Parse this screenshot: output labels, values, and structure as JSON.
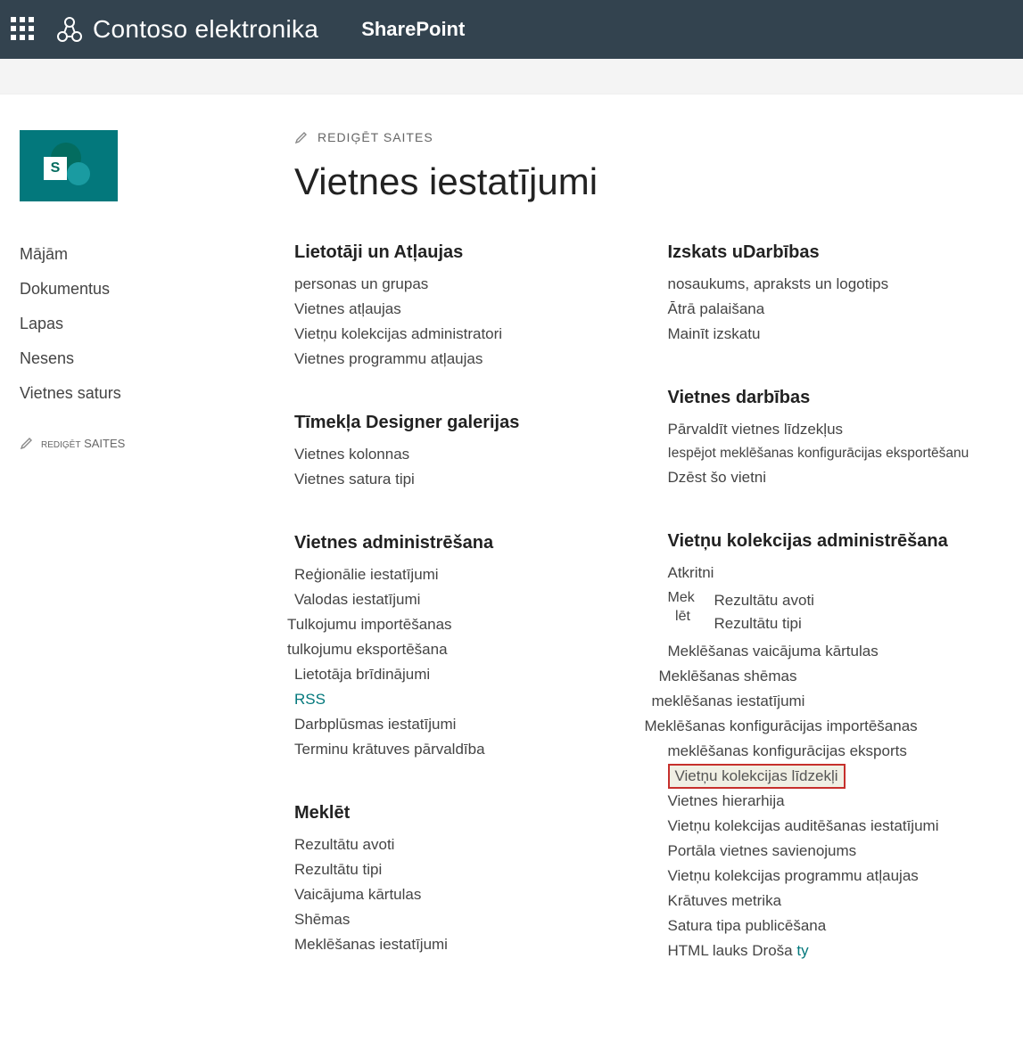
{
  "suite": {
    "brand": "Contoso elektronika",
    "product": "SharePoint"
  },
  "siteLogoLetter": "S",
  "nav": {
    "items": [
      "Mājām",
      "Dokumentus",
      "Lapas",
      "Nesens",
      "Vietnes saturs"
    ],
    "editLabel": "SAITES",
    "editPrefix": "REDIĢĒT"
  },
  "topEdit": "REDIĢĒT SAITES",
  "pageTitle": "Vietnes iestatījumi",
  "left": {
    "g1": {
      "title": "Lietotāji un  Atļaujas",
      "items": [
        "personas un grupas",
        "Vietnes atļaujas",
        "Vietņu kolekcijas administratori",
        "Vietnes programmu atļaujas"
      ]
    },
    "g2": {
      "title": "Tīmekļa Designer galerijas",
      "items": [
        "Vietnes kolonnas",
        "Vietnes satura tipi"
      ]
    },
    "g3": {
      "title": "Vietnes administrēšana",
      "items": [
        "Reģionālie iestatījumi",
        "Valodas iestatījumi",
        "Tulkojumu importēšanas",
        "tulkojumu eksportēšana",
        "Lietotāja brīdinājumi",
        "RSS",
        "Darbplūsmas iestatījumi",
        "Terminu krātuves pārvaldība"
      ]
    },
    "g4": {
      "title": "Meklēt",
      "items": [
        "Rezultātu avoti",
        "Rezultātu tipi",
        "Vaicājuma kārtulas",
        "Shēmas",
        "Meklēšanas iestatījumi"
      ]
    }
  },
  "right": {
    "g1": {
      "title": "Izskats uDarbības",
      "items": [
        "nosaukums, apraksts un logotips",
        "Ātrā palaišana",
        "Mainīt izskatu"
      ]
    },
    "g2": {
      "title": "Vietnes darbības",
      "items": [
        "Pārvaldīt vietnes līdzekļus",
        "Iespējot meklēšanas konfigurācijas eksportēšanu",
        "Dzēst šo vietni"
      ]
    },
    "g3": {
      "title": "Vietņu kolekcijas administrēšana",
      "recycle": "Atkritni",
      "mekLabel": "Mek lēt",
      "mekItems": [
        "Rezultātu avoti",
        "Rezultātu tipi"
      ],
      "items": [
        "Meklēšanas vaicājuma kārtulas",
        "Meklēšanas shēmas",
        "meklēšanas iestatījumi",
        "Meklēšanas konfigurācijas importēšanas",
        "meklēšanas konfigurācijas eksports"
      ],
      "highlighted": "Vietņu kolekcijas līdzekļi",
      "items2": [
        "Vietnes hierarhija",
        "Vietņu kolekcijas auditēšanas iestatījumi",
        "Portāla vietnes savienojums",
        "Vietņu kolekcijas programmu atļaujas",
        "Krātuves metrika",
        "Satura tipa publicēšana"
      ],
      "lastPrefix": "HTML lauks   Droša",
      "lastSuffix": "ty"
    }
  }
}
